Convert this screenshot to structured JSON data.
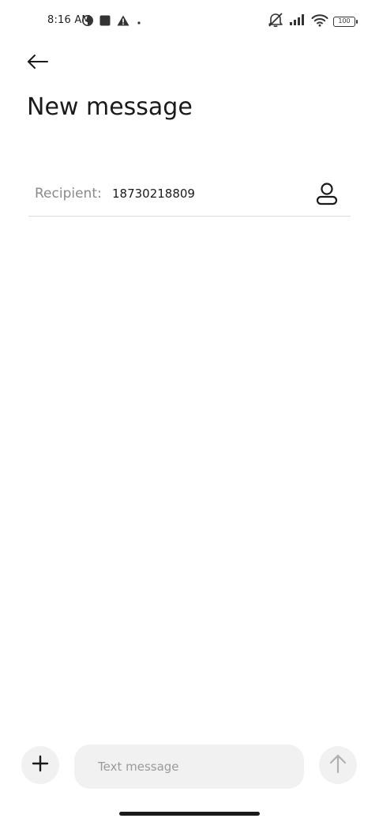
{
  "status_bar": {
    "time": "8:16 AM",
    "left_icons": [
      "circle-half-icon",
      "square-icon",
      "warning-icon",
      "dot-icon"
    ],
    "right_icons": [
      "mute-icon",
      "signal-icon",
      "wifi-icon",
      "battery-icon"
    ],
    "battery_level": "100"
  },
  "header": {
    "back_icon": "arrow-left-icon",
    "title": "New message"
  },
  "recipient": {
    "label": "Recipient:",
    "value": "18730218809",
    "contact_icon": "person-icon"
  },
  "composer": {
    "attach_icon": "plus-icon",
    "placeholder": "Text message",
    "send_icon": "arrow-up-icon"
  },
  "colors": {
    "background": "#ffffff",
    "text": "#1a1a1a",
    "muted": "#8a8a8a",
    "surface": "#f1f1f1",
    "divider": "#d9d9d9"
  }
}
